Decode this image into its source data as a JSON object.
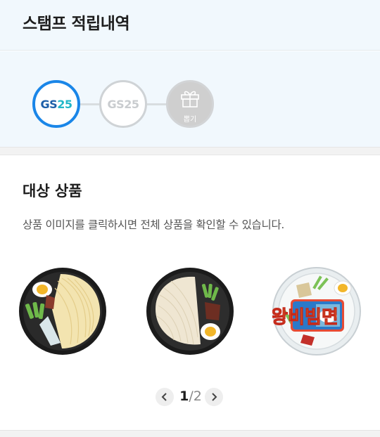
{
  "header": {
    "title": "스탬프 적립내역"
  },
  "stamps": [
    {
      "gs": "GS",
      "num": "25",
      "state": "active"
    },
    {
      "label": "GS25",
      "state": "inactive"
    },
    {
      "draw_label": "뽑기",
      "icon": "gift-icon"
    }
  ],
  "colors": {
    "accent": "#1a86e8",
    "brand_teal": "#22b7c8",
    "brand_navy": "#1d5fa8",
    "header_bg": "#f1f8fd"
  },
  "section": {
    "title": "대상 상품",
    "description": "상품 이미지를 클릭하시면 전체 상품을 확인할 수 있습니다."
  },
  "products": [
    {
      "icon": "noodle-bowl-egg-image"
    },
    {
      "icon": "noodle-bowl-beef-image"
    },
    {
      "icon": "bibim-noodle-bowl-image",
      "package_text": "왕비빔면"
    }
  ],
  "pager": {
    "current": "1",
    "separator": "/",
    "total": "2"
  }
}
